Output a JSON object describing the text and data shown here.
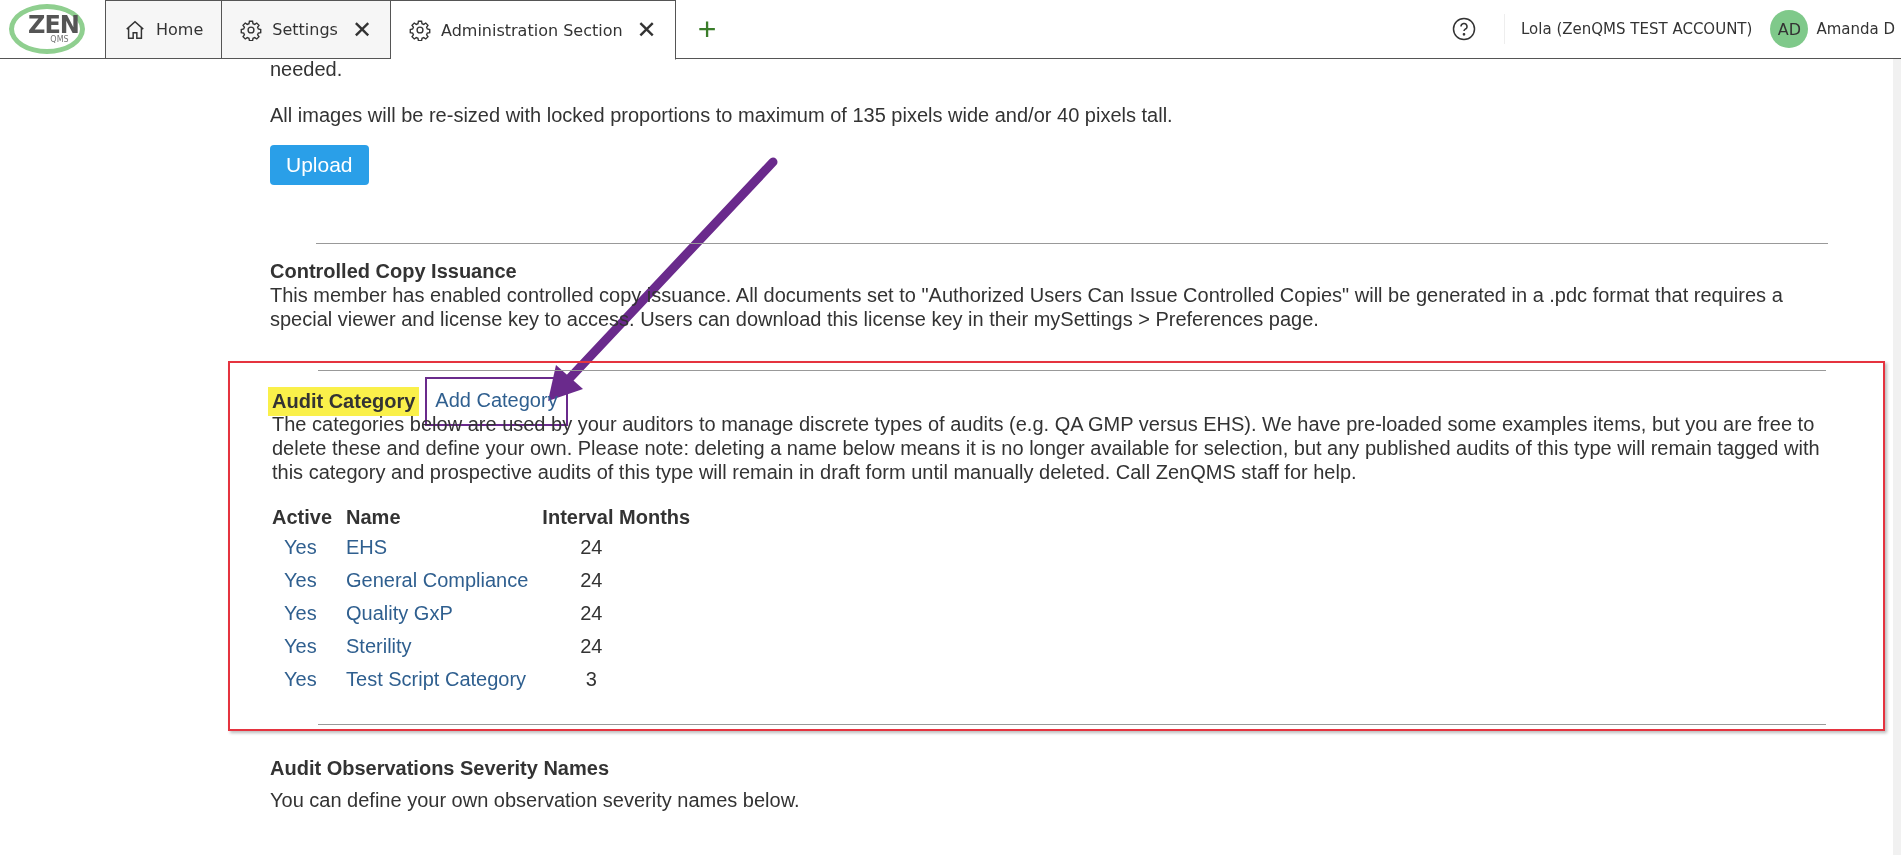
{
  "header": {
    "logo": {
      "text": "ZEN",
      "subtext": "QMS"
    },
    "tabs": [
      {
        "label": "Home",
        "selected": false
      },
      {
        "label": "Settings",
        "close": "✕",
        "selected": false
      },
      {
        "label": "Administration Section",
        "close": "✕",
        "selected": true
      }
    ],
    "add_tab": "+",
    "account": "Lola (ZenQMS TEST ACCOUNT)",
    "avatar": "AD",
    "user": "Amanda D"
  },
  "upload_section": {
    "cut_text": "needed.",
    "note": "All images will be re-sized with locked proportions to maximum of 135 pixels wide and/or 40 pixels tall.",
    "button": "Upload"
  },
  "controlled_copy": {
    "title": "Controlled Copy Issuance",
    "text": "This member has enabled controlled copy issuance. All documents set to \"Authorized Users Can Issue Controlled Copies\" will be generated in a .pdc format that requires a special viewer and license key to access. Users can download this license key in their mySettings > Preferences page."
  },
  "audit_category": {
    "framed": true,
    "title": "Audit Category",
    "title_highlighted": true,
    "add_link": "Add Category",
    "add_link_framed": true,
    "description": "The categories below are used by your auditors to manage discrete types of audits (e.g. QA GMP versus EHS). We have pre-loaded some examples items, but you are free to delete these and define your own. Please note: deleting a name below means it is no longer available for selection, but any published audits of this type will remain tagged with this category and prospective audits of this type will remain in draft form until manually deleted. Call ZenQMS staff for help.",
    "columns": [
      "Active",
      "Name",
      "Interval Months"
    ],
    "rows": [
      {
        "active": "Yes",
        "name": "EHS",
        "interval": "24"
      },
      {
        "active": "Yes",
        "name": "General Compliance",
        "interval": "24"
      },
      {
        "active": "Yes",
        "name": "Quality GxP",
        "interval": "24"
      },
      {
        "active": "Yes",
        "name": "Sterility",
        "interval": "24"
      },
      {
        "active": "Yes",
        "name": "Test Script Category",
        "interval": "3"
      }
    ]
  },
  "audit_observations": {
    "title": "Audit Observations Severity Names",
    "text": "You can define your own observation severity names below."
  }
}
